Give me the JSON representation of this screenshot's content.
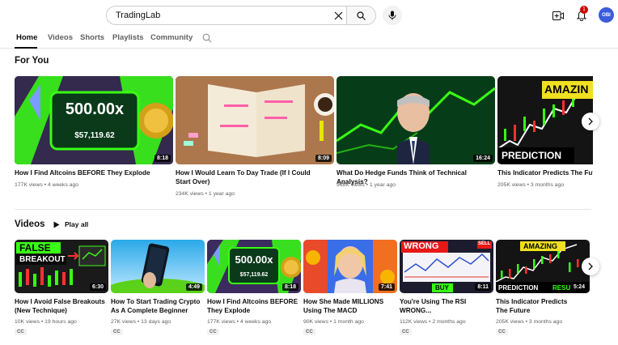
{
  "search": {
    "query": "TradingLab"
  },
  "header": {
    "notification_count": "1",
    "avatar_text": "OBI"
  },
  "tabs": [
    "Home",
    "Videos",
    "Shorts",
    "Playlists",
    "Community"
  ],
  "sections": {
    "for_you": "For You",
    "videos": "Videos",
    "play_all": "Play all"
  },
  "for_you_videos": [
    {
      "title": "How I Find Altcoins BEFORE They Explode",
      "meta": "177K views • 4 weeks ago",
      "duration": "8:18",
      "thumb_text": [
        "500.00x",
        "$57,119.62"
      ]
    },
    {
      "title": "How I Would Learn To Day Trade (If I Could Start Over)",
      "meta": "234K views • 1 year ago",
      "duration": "8:09"
    },
    {
      "title": "What Do Hedge Funds Think of Technical Analysis?",
      "meta": "968K views • 1 year ago",
      "duration": "16:24"
    },
    {
      "title": "This Indicator Predicts The Future",
      "meta": "205K views • 3 months ago",
      "duration": "",
      "thumb_text": [
        "AMAZIN",
        "PREDICTION"
      ]
    }
  ],
  "videos": [
    {
      "title": "How I Avoid False Breakouts (New Technique)",
      "meta": "10K views • 19 hours ago",
      "duration": "6:30",
      "cc": "CC",
      "thumb_text": [
        "FALSE",
        "BREAKOUT"
      ]
    },
    {
      "title": "How To Start Trading Crypto As A Complete Beginner",
      "meta": "27K views • 13 days ago",
      "duration": "4:49",
      "cc": "CC"
    },
    {
      "title": "How I Find Altcoins BEFORE They Explode",
      "meta": "177K views • 4 weeks ago",
      "duration": "8:18",
      "cc": "CC",
      "thumb_text": [
        "500.00x",
        "$57,119.62"
      ]
    },
    {
      "title": "How She Made MILLIONS Using The MACD",
      "meta": "90K views • 1 month ago",
      "duration": "7:41",
      "cc": "CC"
    },
    {
      "title": "You're Using The RSI WRONG...",
      "meta": "112K views • 2 months ago",
      "duration": "8:11",
      "cc": "CC",
      "thumb_text": [
        "WRONG",
        "SELL",
        "BUY"
      ]
    },
    {
      "title": "This Indicator Predicts The Future",
      "meta": "205K views • 3 months ago",
      "duration": "5:24",
      "cc": "CC",
      "thumb_text": [
        "AMAZING",
        "PREDICTION",
        "RESU"
      ]
    }
  ],
  "colors": {
    "accent": "#0f0f0f",
    "badge": "#cc0000",
    "neon_green": "#39ff14",
    "avatar": "#3b5bdb"
  },
  "icons": [
    "clear-icon",
    "search-icon",
    "mic-icon",
    "create-icon",
    "bell-icon",
    "play-icon",
    "chevron-right-icon"
  ]
}
